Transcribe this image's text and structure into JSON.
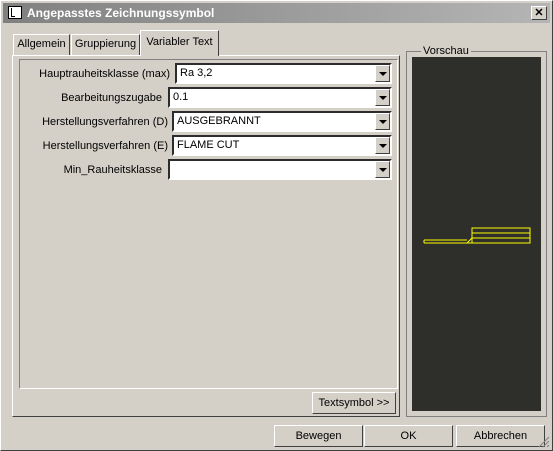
{
  "window": {
    "title": "Angepasstes Zeichnungssymbol"
  },
  "tabs": [
    {
      "label": "Allgemein"
    },
    {
      "label": "Gruppierung"
    },
    {
      "label": "Variabler Text"
    }
  ],
  "fields": [
    {
      "label": "Hauptrauheitsklasse (max)",
      "value": "Ra 3,2"
    },
    {
      "label": "Bearbeitungszugabe",
      "value": "0.1"
    },
    {
      "label": "Herstellungsverfahren (D)",
      "value": "AUSGEBRANNT"
    },
    {
      "label": "Herstellungsverfahren (E)",
      "value": "FLAME CUT"
    },
    {
      "label": "Min_Rauheitsklasse",
      "value": ""
    }
  ],
  "buttons": {
    "textsymbol": "Textsymbol >>",
    "bewegen": "Bewegen",
    "ok": "OK",
    "abbrechen": "Abbrechen"
  },
  "preview": {
    "label": "Vorschau",
    "symbol_color": "#ffff00",
    "background": "#2e2e2a"
  },
  "icons": {
    "app": "drawing-symbol-icon",
    "close": "close-icon",
    "dropdown": "chevron-down-icon"
  }
}
